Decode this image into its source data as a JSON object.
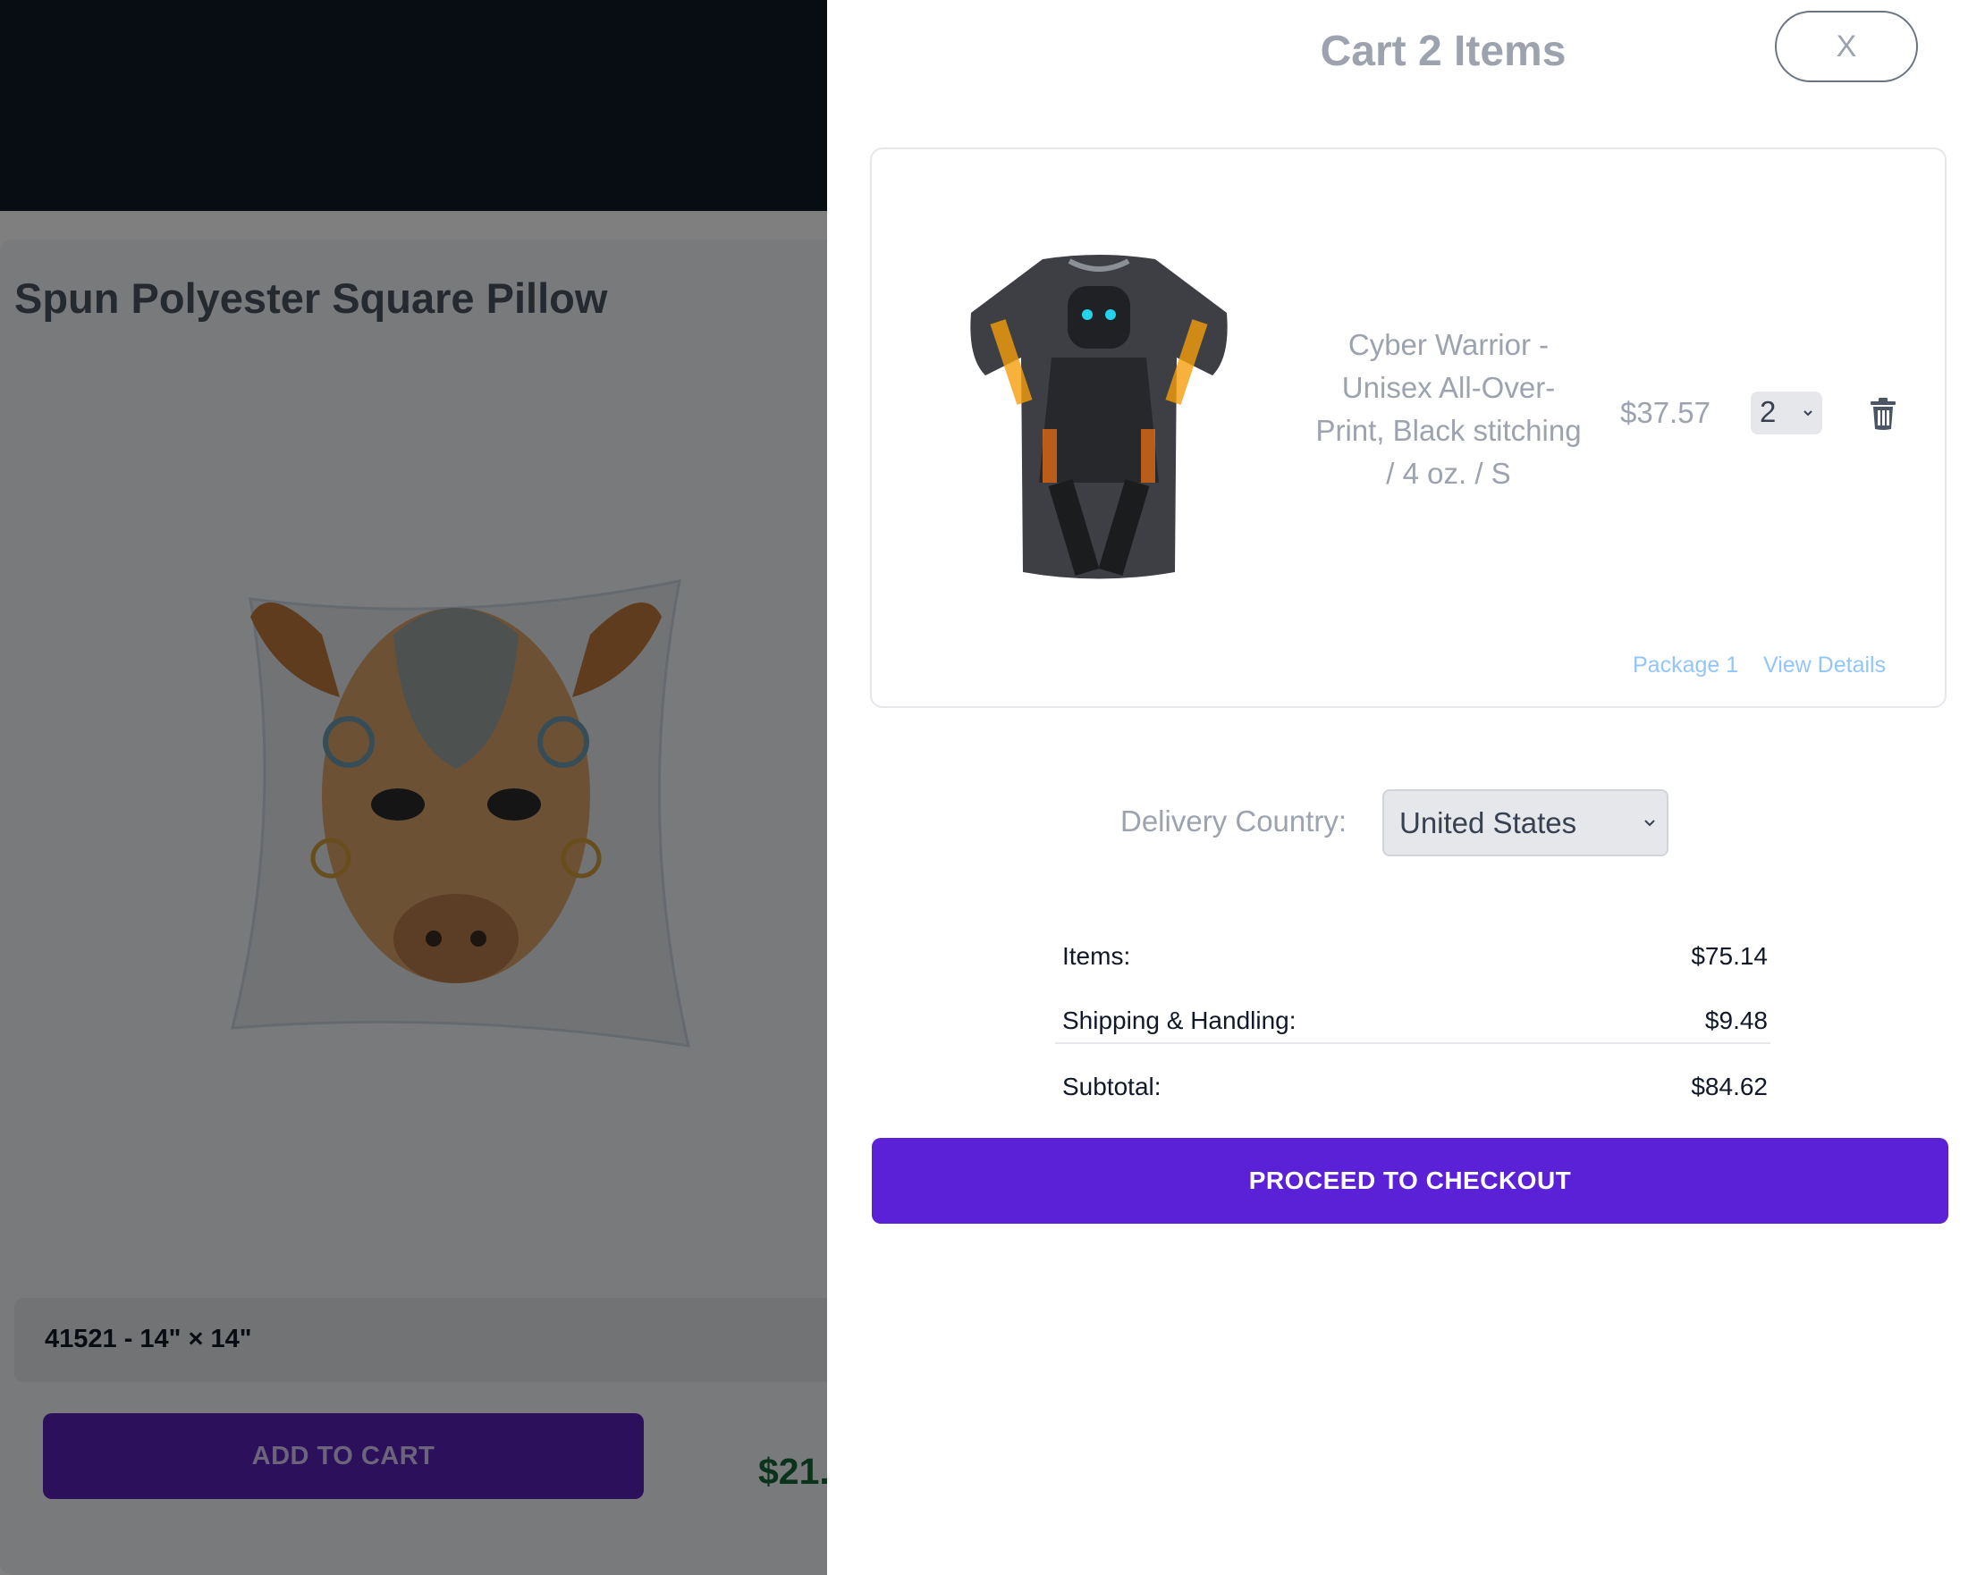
{
  "background_page": {
    "product_title": "Spun Polyester Square Pillow",
    "variant_label": "41521 - 14\" × 14\"",
    "add_to_cart_label": "ADD TO CART",
    "price_partial": "$21."
  },
  "cart": {
    "title": "Cart 2 Items",
    "close_label": "X",
    "items": [
      {
        "name": "Cyber Warrior - Unisex All-Over-Print, Black stitching / 4 oz. / S",
        "price": "$37.57",
        "quantity": "2",
        "package_label": "Package 1",
        "details_label": "View Details"
      }
    ],
    "delivery": {
      "label": "Delivery Country:",
      "selected_country": "United States"
    },
    "summary": {
      "items_label": "Items:",
      "items_value": "$75.14",
      "shipping_label": "Shipping & Handling:",
      "shipping_value": "$9.48",
      "subtotal_label": "Subtotal:",
      "subtotal_value": "$84.62"
    },
    "checkout_label": "PROCEED TO CHECKOUT"
  },
  "colors": {
    "accent": "#5b21d6",
    "topbar": "#111827",
    "link": "#93c5fd"
  },
  "icons": {
    "close": "close-icon",
    "trash": "trash-icon",
    "chevron": "chevron-down-icon"
  }
}
